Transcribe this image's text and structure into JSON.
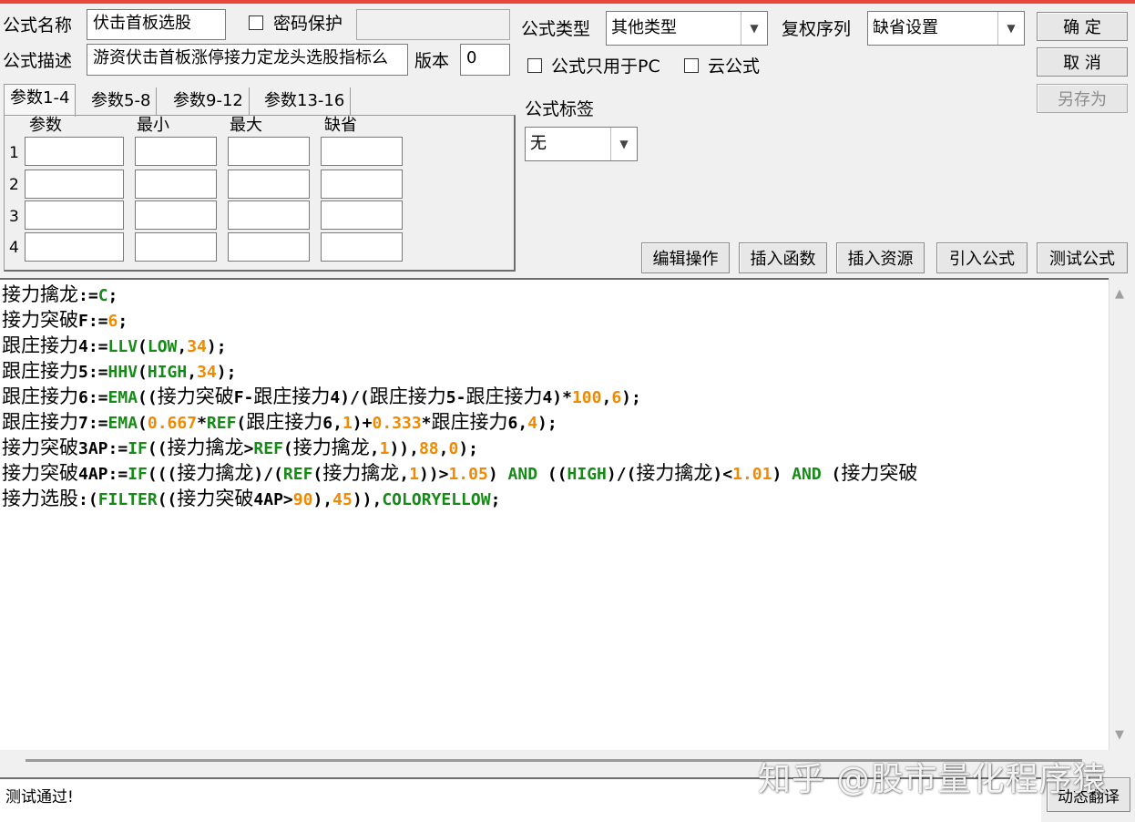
{
  "form": {
    "name_label": "公式名称",
    "name_value": "伏击首板选股",
    "password_label": "密码保护",
    "desc_label": "公式描述",
    "desc_value": "游资伏击首板涨停接力定龙头选股指标么",
    "version_label": "版本",
    "version_value": "0",
    "type_label": "公式类型",
    "type_value": "其他类型",
    "rights_label": "复权序列",
    "rights_value": "缺省设置",
    "pc_only_label": "公式只用于PC",
    "cloud_label": "云公式",
    "tag_label": "公式标签",
    "tag_value": "无"
  },
  "buttons": {
    "ok": "确  定",
    "cancel": "取  消",
    "save_as": "另存为",
    "edit_ops": "编辑操作",
    "insert_func": "插入函数",
    "insert_res": "插入资源",
    "import_formula": "引入公式",
    "test_formula": "测试公式",
    "dynamic_translate": "动态翻译"
  },
  "params": {
    "tabs": [
      "参数1-4",
      "参数5-8",
      "参数9-12",
      "参数13-16"
    ],
    "headers": [
      "参数",
      "最小",
      "最大",
      "缺省"
    ],
    "rows": [
      "1",
      "2",
      "3",
      "4"
    ]
  },
  "code_lines": [
    [
      [
        "cn",
        "接力擒龙"
      ],
      [
        "k",
        ":="
      ],
      [
        "g",
        "C"
      ],
      [
        "k",
        ";"
      ]
    ],
    [
      [
        "cn",
        "接力突破"
      ],
      [
        "k",
        "F:="
      ],
      [
        "o",
        "6"
      ],
      [
        "k",
        ";"
      ]
    ],
    [
      [
        "cn",
        "跟庄接力"
      ],
      [
        "k",
        "4:="
      ],
      [
        "g",
        "LLV"
      ],
      [
        "k",
        "("
      ],
      [
        "g",
        "LOW"
      ],
      [
        "k",
        ","
      ],
      [
        "o",
        "34"
      ],
      [
        "k",
        ");"
      ]
    ],
    [
      [
        "cn",
        "跟庄接力"
      ],
      [
        "k",
        "5:="
      ],
      [
        "g",
        "HHV"
      ],
      [
        "k",
        "("
      ],
      [
        "g",
        "HIGH"
      ],
      [
        "k",
        ","
      ],
      [
        "o",
        "34"
      ],
      [
        "k",
        ");"
      ]
    ],
    [
      [
        "cn",
        "跟庄接力"
      ],
      [
        "k",
        "6:="
      ],
      [
        "g",
        "EMA"
      ],
      [
        "k",
        "(("
      ],
      [
        "cn",
        "接力突破"
      ],
      [
        "k",
        "F-"
      ],
      [
        "cn",
        "跟庄接力"
      ],
      [
        "k",
        "4)/("
      ],
      [
        "cn",
        "跟庄接力"
      ],
      [
        "k",
        "5-"
      ],
      [
        "cn",
        "跟庄接力"
      ],
      [
        "k",
        "4)*"
      ],
      [
        "o",
        "100"
      ],
      [
        "k",
        ","
      ],
      [
        "o",
        "6"
      ],
      [
        "k",
        ");"
      ]
    ],
    [
      [
        "cn",
        "跟庄接力"
      ],
      [
        "k",
        "7:="
      ],
      [
        "g",
        "EMA"
      ],
      [
        "k",
        "("
      ],
      [
        "o",
        "0.667"
      ],
      [
        "k",
        "*"
      ],
      [
        "g",
        "REF"
      ],
      [
        "k",
        "("
      ],
      [
        "cn",
        "跟庄接力"
      ],
      [
        "k",
        "6,"
      ],
      [
        "o",
        "1"
      ],
      [
        "k",
        ")+"
      ],
      [
        "o",
        "0.333"
      ],
      [
        "k",
        "*"
      ],
      [
        "cn",
        "跟庄接力"
      ],
      [
        "k",
        "6,"
      ],
      [
        "o",
        "4"
      ],
      [
        "k",
        ");"
      ]
    ],
    [
      [
        "cn",
        "接力突破"
      ],
      [
        "k",
        "3AP:="
      ],
      [
        "g",
        "IF"
      ],
      [
        "k",
        "(("
      ],
      [
        "cn",
        "接力擒龙"
      ],
      [
        "k",
        ">"
      ],
      [
        "g",
        "REF"
      ],
      [
        "k",
        "("
      ],
      [
        "cn",
        "接力擒龙"
      ],
      [
        "k",
        ","
      ],
      [
        "o",
        "1"
      ],
      [
        "k",
        ")),"
      ],
      [
        "o",
        "88"
      ],
      [
        "k",
        ","
      ],
      [
        "o",
        "0"
      ],
      [
        "k",
        ");"
      ]
    ],
    [
      [
        "cn",
        "接力突破"
      ],
      [
        "k",
        "4AP:="
      ],
      [
        "g",
        "IF"
      ],
      [
        "k",
        "((("
      ],
      [
        "cn",
        "接力擒龙"
      ],
      [
        "k",
        ")/("
      ],
      [
        "g",
        "REF"
      ],
      [
        "k",
        "("
      ],
      [
        "cn",
        "接力擒龙"
      ],
      [
        "k",
        ","
      ],
      [
        "o",
        "1"
      ],
      [
        "k",
        "))>"
      ],
      [
        "o",
        "1.05"
      ],
      [
        "k",
        ") "
      ],
      [
        "g",
        "AND"
      ],
      [
        "k",
        " (("
      ],
      [
        "g",
        "HIGH"
      ],
      [
        "k",
        ")/("
      ],
      [
        "cn",
        "接力擒龙"
      ],
      [
        "k",
        ")<"
      ],
      [
        "o",
        "1.01"
      ],
      [
        "k",
        ") "
      ],
      [
        "g",
        "AND"
      ],
      [
        "k",
        " ("
      ],
      [
        "cn",
        "接力突破"
      ]
    ],
    [
      [
        "cn",
        "接力选股"
      ],
      [
        "k",
        ":("
      ],
      [
        "g",
        "FILTER"
      ],
      [
        "k",
        "(("
      ],
      [
        "cn",
        "接力突破"
      ],
      [
        "k",
        "4AP>"
      ],
      [
        "o",
        "90"
      ],
      [
        "k",
        "),"
      ],
      [
        "o",
        "45"
      ],
      [
        "k",
        ")),"
      ],
      [
        "g",
        "COLORYELLOW"
      ],
      [
        "k",
        ";"
      ]
    ]
  ],
  "status_text": "测试通过!",
  "watermark": "知乎 @股市量化程序猿"
}
